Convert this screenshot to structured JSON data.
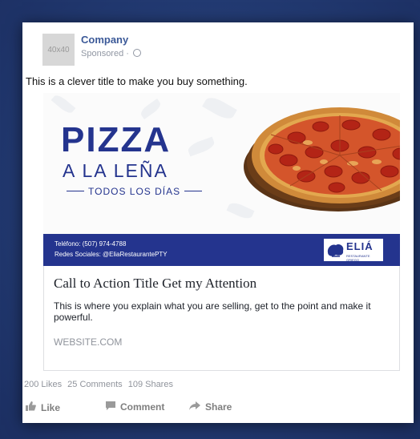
{
  "post": {
    "avatar_placeholder": "40x40",
    "company": "Company",
    "sponsored": "Sponsored ·",
    "text": "This is a clever title to make you buy something."
  },
  "creative": {
    "headline": "PIZZA",
    "subhead": "A LA LEÑA",
    "tagline": "TODOS LOS DÍAS",
    "phone": "Teléfono: (507) 974-4788",
    "social": "Redes Sociales: @EliaRestaurantePTY",
    "brand": "ELIÁ",
    "brand_small": "RESTAURANTE GRIEGO",
    "colors": {
      "brand_blue": "#24348e",
      "pizza_red": "#c8321f"
    }
  },
  "cta": {
    "title": "Call to Action Title Get my Attention",
    "description": "This is where you explain what you are selling, get to the point and make it powerful.",
    "website": "WEBSITE.COM"
  },
  "stats": {
    "likes": "200 Likes",
    "comments": "25 Comments",
    "shares": "109 Shares"
  },
  "actions": {
    "like": "Like",
    "comment": "Comment",
    "share": "Share",
    "icons": {
      "like": "thumbs-up-icon",
      "comment": "comment-icon",
      "share": "share-arrow-icon"
    }
  }
}
